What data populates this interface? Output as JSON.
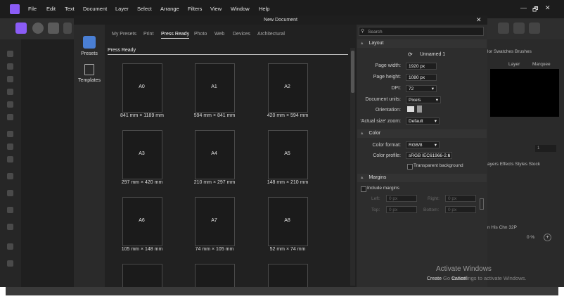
{
  "menubar": {
    "items": [
      "File",
      "Edit",
      "Text",
      "Document",
      "Layer",
      "Select",
      "Arrange",
      "Filters",
      "View",
      "Window",
      "Help"
    ],
    "win_min": "—",
    "win_max": "🗗",
    "win_close": "✕"
  },
  "dialog": {
    "title": "New Document",
    "close": "✕",
    "nav": [
      {
        "label": "Presets"
      },
      {
        "label": "Templates"
      }
    ],
    "tabs": [
      "My Presets",
      "Print",
      "Press Ready",
      "Photo",
      "Web",
      "Devices",
      "Architectural"
    ],
    "section_title": "Press Ready",
    "presets": [
      {
        "name": "A0",
        "size": "841 mm × 1189 mm"
      },
      {
        "name": "A1",
        "size": "594 mm × 841 mm"
      },
      {
        "name": "A2",
        "size": "420 mm × 594 mm"
      },
      {
        "name": "A3",
        "size": "297 mm × 420 mm"
      },
      {
        "name": "A4",
        "size": "210 mm × 297 mm"
      },
      {
        "name": "A5",
        "size": "148 mm × 210 mm"
      },
      {
        "name": "A6",
        "size": "105 mm × 148 mm"
      },
      {
        "name": "A7",
        "size": "74 mm × 105 mm"
      },
      {
        "name": "A8",
        "size": "52 mm × 74 mm"
      }
    ]
  },
  "settings": {
    "search_placeholder": "Search",
    "layout_header": "Layout",
    "doc_name": "Unnamed 1",
    "page_width_label": "Page width:",
    "page_width": "1920 px",
    "page_height_label": "Page height:",
    "page_height": "1080 px",
    "dpi_label": "DPI:",
    "dpi": "72",
    "units_label": "Document units:",
    "units": "Pixels",
    "orientation_label": "Orientation:",
    "zoom_label": "'Actual size' zoom:",
    "zoom": "Default",
    "color_header": "Color",
    "color_format_label": "Color format:",
    "color_format": "RGB/8",
    "color_profile_label": "Color profile:",
    "color_profile": "sRGB IEC61966-2.1",
    "transparent_bg": "Transparent background",
    "margins_header": "Margins",
    "include_margins": "Include margins",
    "left_label": "Left:",
    "right_label": "Right:",
    "top_label": "Top:",
    "bottom_label": "Bottom:",
    "margin_value": "0 px",
    "create": "Create",
    "cancel": "Cancel"
  },
  "rightapp": {
    "tabs1": "lor  Swatches  Brushes",
    "layer": "Layer",
    "marquee": "Marquee",
    "tabs2": "ayers  Effects  Styles  Stock",
    "tabs3": "n  His  Chn  32P",
    "zoom_pct": "0 %",
    "field_1": "1"
  },
  "watermark": {
    "line1": "Activate Windows",
    "line2": "Go to Settings to activate Windows."
  },
  "colors": {
    "accent": "#8b5cf6",
    "nav_active": "#4a7fd4"
  }
}
